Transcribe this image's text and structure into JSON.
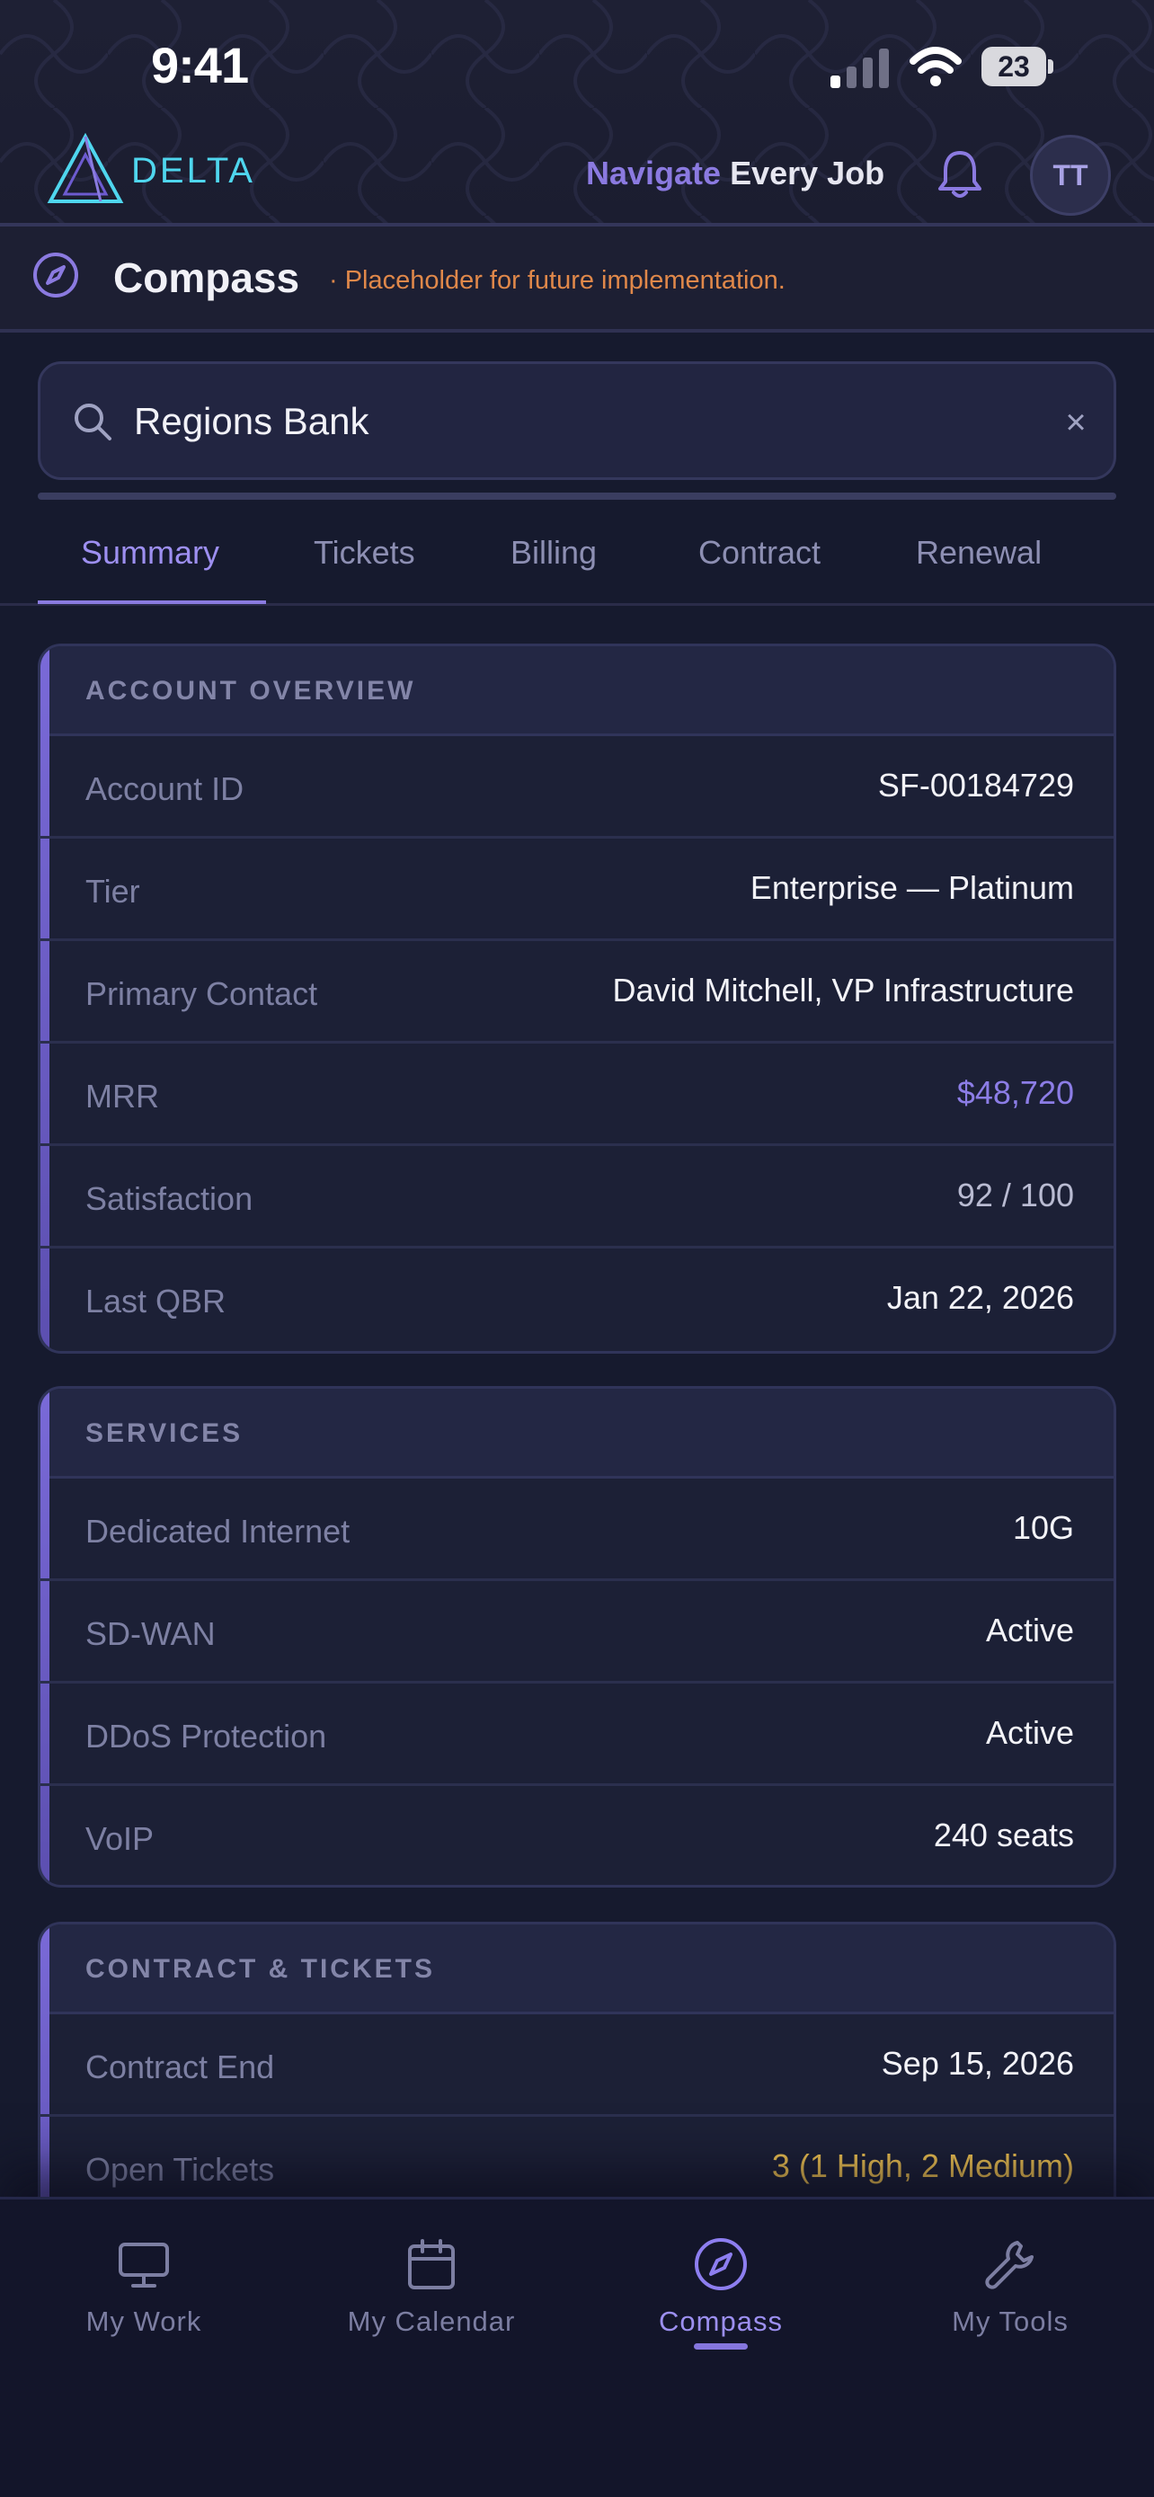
{
  "status_bar": {
    "time": "9:41",
    "battery": "23"
  },
  "brand": {
    "name": "DELTA",
    "tagline_accent": "Navigate",
    "tagline_rest": " Every Job",
    "avatar_initials": "TT"
  },
  "subheader": {
    "title": "Compass",
    "note": "· Placeholder for future implementation."
  },
  "search": {
    "value": "Regions Bank",
    "clear_label": "×"
  },
  "tabs": [
    "Summary",
    "Tickets",
    "Billing",
    "Contract",
    "Renewal"
  ],
  "cards": {
    "overview": {
      "title": "ACCOUNT OVERVIEW",
      "rows": [
        {
          "label": "Account ID",
          "value": "SF-00184729"
        },
        {
          "label": "Tier",
          "value": "Enterprise — Platinum"
        },
        {
          "label": "Primary Contact",
          "value": "David Mitchell, VP Infrastructure"
        },
        {
          "label": "MRR",
          "value": "$48,720"
        },
        {
          "label": "Satisfaction",
          "value": "92 / 100"
        },
        {
          "label": "Last QBR",
          "value": "Jan 22, 2026"
        }
      ]
    },
    "services": {
      "title": "SERVICES",
      "rows": [
        {
          "label": "Dedicated Internet",
          "value": "10G"
        },
        {
          "label": "SD-WAN",
          "value": "Active"
        },
        {
          "label": "DDoS Protection",
          "value": "Active"
        },
        {
          "label": "VoIP",
          "value": "240 seats"
        }
      ]
    },
    "contract": {
      "title": "CONTRACT & TICKETS",
      "rows": [
        {
          "label": "Contract End",
          "value": "Sep 15, 2026"
        },
        {
          "label": "Open Tickets",
          "value": "3 (1 High, 2 Medium)"
        }
      ]
    }
  },
  "bottom_nav": [
    {
      "label": "My Work",
      "icon": "monitor-icon"
    },
    {
      "label": "My Calendar",
      "icon": "calendar-icon"
    },
    {
      "label": "Compass",
      "icon": "compass-icon"
    },
    {
      "label": "My Tools",
      "icon": "wrench-icon"
    }
  ],
  "colors": {
    "accent": "#8b7ae0",
    "brand_cyan": "#4fd6ee",
    "note_orange": "#e0884a",
    "warning_yellow": "#f1c452",
    "background": "#161a2e"
  }
}
